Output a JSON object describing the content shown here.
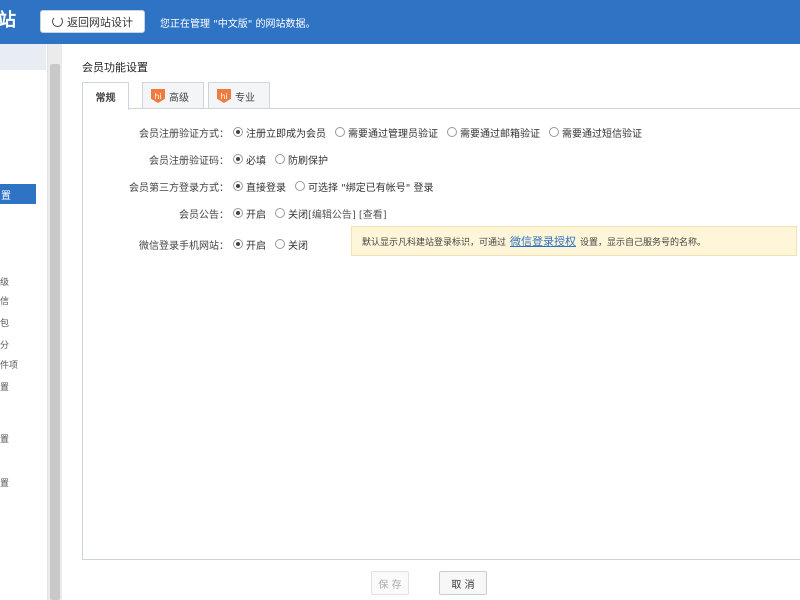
{
  "header": {
    "brand": "站",
    "back_button": "返回网站设计",
    "managing_text": "您正在管理 \"中文版\" 的网站数据。"
  },
  "sidebar": {
    "active_item": "置",
    "items": [
      "级",
      "信",
      "包",
      "分",
      "件项",
      "置",
      "置",
      "置"
    ]
  },
  "page": {
    "section_title": "会员功能设置",
    "tabs": [
      {
        "label": "常规",
        "active": true
      },
      {
        "label": "高级",
        "badge": "hi"
      },
      {
        "label": "专业",
        "badge": "hi"
      }
    ]
  },
  "form": {
    "rows": [
      {
        "label": "会员注册验证方式：",
        "options": [
          "注册立即成为会员",
          "需要通过管理员验证",
          "需要通过邮箱验证",
          "需要通过短信验证"
        ],
        "selected": 0
      },
      {
        "label": "会员注册验证码：",
        "options": [
          "必填",
          "防刷保护"
        ],
        "selected": 0
      },
      {
        "label": "会员第三方登录方式：",
        "options": [
          "直接登录",
          "可选择 \"绑定已有帐号\" 登录"
        ],
        "selected": 0
      },
      {
        "label": "会员公告：",
        "options": [
          "开启",
          "关闭"
        ],
        "selected": 0,
        "extra_links": [
          "[编辑公告]",
          "[查看]"
        ]
      },
      {
        "label": "微信登录手机网站：",
        "options": [
          "开启",
          "关闭"
        ],
        "selected": 0
      }
    ],
    "tip": {
      "before": "默认显示凡科建站登录标识，可通过",
      "link": "微信登录授权",
      "after": "设置，显示自己服务号的名称。"
    }
  },
  "footer": {
    "save": "保 存",
    "cancel": "取 消"
  }
}
